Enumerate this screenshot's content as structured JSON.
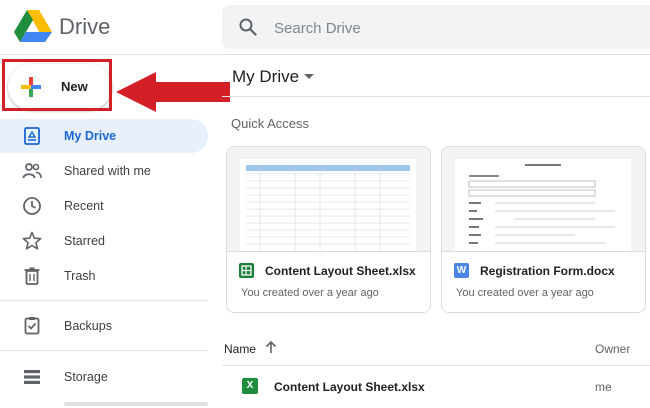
{
  "header": {
    "brand": "Drive",
    "search_placeholder": "Search Drive"
  },
  "sidebar": {
    "new_label": "New",
    "items": [
      {
        "label": "My Drive",
        "icon": "my-drive-icon",
        "active": true
      },
      {
        "label": "Shared with me",
        "icon": "people-icon"
      },
      {
        "label": "Recent",
        "icon": "clock-icon"
      },
      {
        "label": "Starred",
        "icon": "star-icon"
      },
      {
        "label": "Trash",
        "icon": "trash-icon"
      },
      {
        "label": "Backups",
        "icon": "backup-icon"
      },
      {
        "label": "Storage",
        "icon": "storage-icon"
      }
    ]
  },
  "main": {
    "title": "My Drive",
    "quick_access": {
      "title": "Quick Access",
      "cards": [
        {
          "name": "Content Layout Sheet.xlsx",
          "subtitle": "You created over a year ago",
          "type": "sheets"
        },
        {
          "name": "Registration Form.docx",
          "subtitle": "You created over a year ago",
          "type": "word"
        }
      ]
    },
    "list": {
      "col_name": "Name",
      "col_owner": "Owner",
      "rows": [
        {
          "name": "Content Layout Sheet.xlsx",
          "owner": "me",
          "type": "excel"
        }
      ]
    }
  },
  "colors": {
    "accent": "#1967d2",
    "active_bg": "#e8f0fe",
    "annotation_red": "#d32027",
    "sheets_green": "#188038",
    "word_blue": "#4a86e8"
  }
}
